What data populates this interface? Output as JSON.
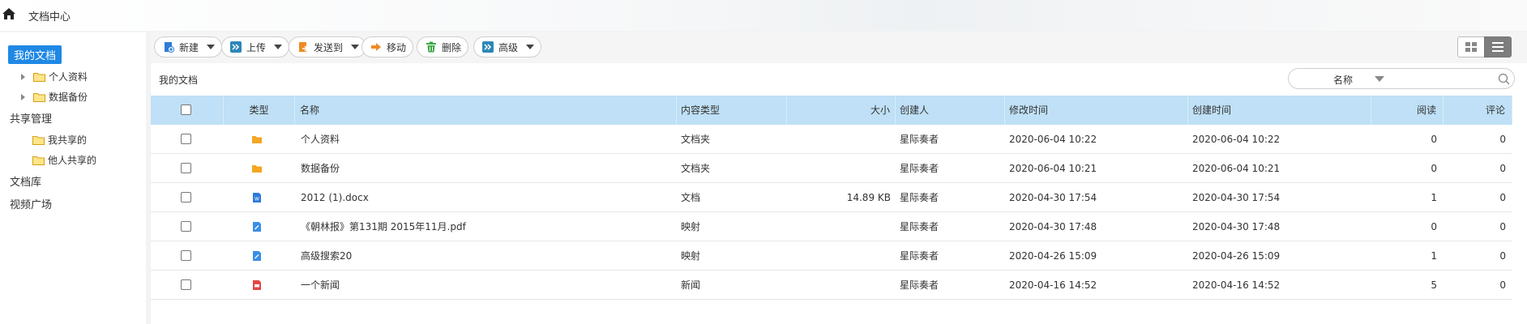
{
  "app": {
    "title": "文档中心"
  },
  "sidebar": {
    "my_docs": "我的文档",
    "my_docs_children": [
      "个人资料",
      "数据备份"
    ],
    "share_mgmt": "共享管理",
    "share_children": [
      "我共享的",
      "他人共享的"
    ],
    "library": "文档库",
    "video": "视频广场"
  },
  "toolbar": {
    "new_label": "新建",
    "upload_label": "上传",
    "sendto_label": "发送到",
    "move_label": "移动",
    "delete_label": "删除",
    "advanced_label": "高级"
  },
  "breadcrumb": "我的文档",
  "search": {
    "field_label": "名称",
    "placeholder": ""
  },
  "table": {
    "headers": {
      "type": "类型",
      "name": "名称",
      "content_type": "内容类型",
      "size": "大小",
      "creator": "创建人",
      "modified": "修改时间",
      "created": "创建时间",
      "reads": "阅读",
      "comments": "评论"
    },
    "rows": [
      {
        "icon": "folder-icon",
        "name": "个人资料",
        "content_type": "文档夹",
        "size": "",
        "creator": "星际奏者",
        "modified": "2020-06-04 10:22",
        "created": "2020-06-04 10:22",
        "reads": "0",
        "comments": "0"
      },
      {
        "icon": "folder-icon",
        "name": "数据备份",
        "content_type": "文档夹",
        "size": "",
        "creator": "星际奏者",
        "modified": "2020-06-04 10:21",
        "created": "2020-06-04 10:21",
        "reads": "0",
        "comments": "0"
      },
      {
        "icon": "word-doc-icon",
        "name": "2012 (1).docx",
        "content_type": "文档",
        "size": "14.89 KB",
        "creator": "星际奏者",
        "modified": "2020-04-30 17:54",
        "created": "2020-04-30 17:54",
        "reads": "1",
        "comments": "0"
      },
      {
        "icon": "mapping-doc-icon",
        "name": "《朝林报》第131期 2015年11月.pdf",
        "content_type": "映射",
        "size": "",
        "creator": "星际奏者",
        "modified": "2020-04-30 17:48",
        "created": "2020-04-30 17:48",
        "reads": "0",
        "comments": "0"
      },
      {
        "icon": "mapping-doc-icon",
        "name": "高级搜索20",
        "content_type": "映射",
        "size": "",
        "creator": "星际奏者",
        "modified": "2020-04-26 15:09",
        "created": "2020-04-26 15:09",
        "reads": "1",
        "comments": "0"
      },
      {
        "icon": "news-icon",
        "name": "一个新闻",
        "content_type": "新闻",
        "size": "",
        "creator": "星际奏者",
        "modified": "2020-04-16 14:52",
        "created": "2020-04-16 14:52",
        "reads": "5",
        "comments": "0"
      }
    ]
  },
  "colors": {
    "accent": "#1f88e5",
    "header_bg": "#bfe0f6",
    "folder": "#f5a623",
    "word": "#2f7bd9",
    "mapping": "#3a8ee6",
    "news": "#e54545"
  }
}
